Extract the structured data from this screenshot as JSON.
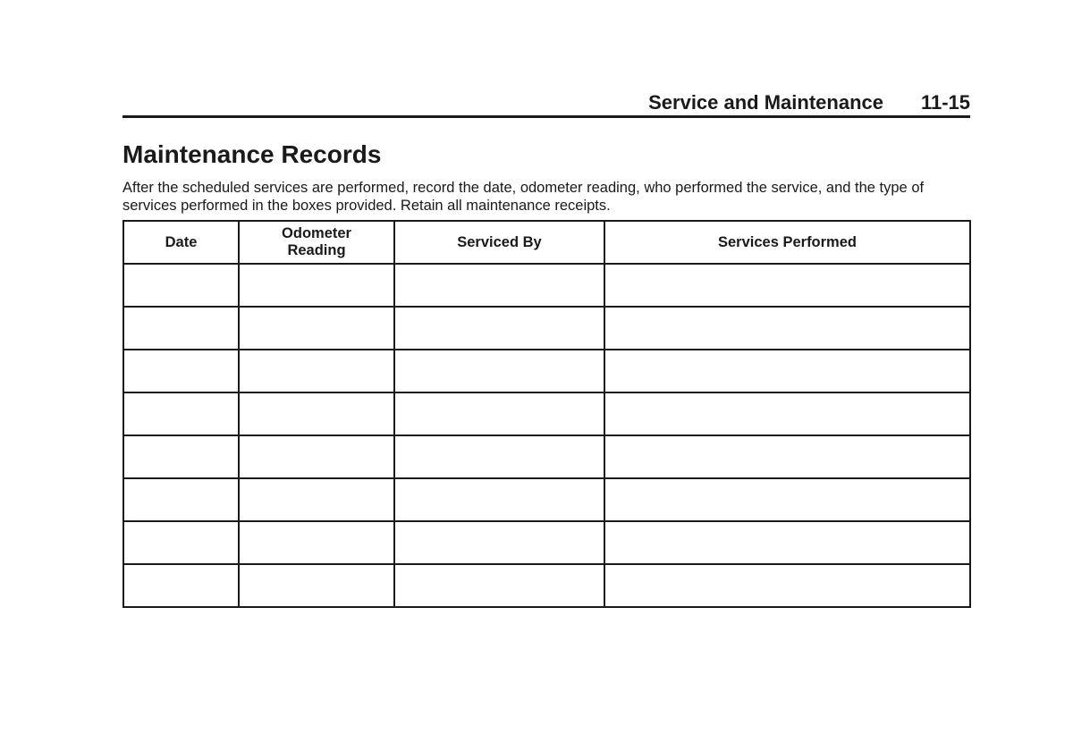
{
  "header": {
    "section": "Service and Maintenance",
    "page_number": "11-15"
  },
  "title": "Maintenance Records",
  "intro": "After the scheduled services are performed, record the date, odometer reading, who performed the service, and the type of services performed in the boxes provided. Retain all maintenance receipts.",
  "table": {
    "columns": [
      {
        "line1": "Date",
        "line2": ""
      },
      {
        "line1": "Odometer",
        "line2": "Reading"
      },
      {
        "line1": "Serviced By",
        "line2": ""
      },
      {
        "line1": "Services Performed",
        "line2": ""
      }
    ],
    "rows": [
      [
        "",
        "",
        "",
        ""
      ],
      [
        "",
        "",
        "",
        ""
      ],
      [
        "",
        "",
        "",
        ""
      ],
      [
        "",
        "",
        "",
        ""
      ],
      [
        "",
        "",
        "",
        ""
      ],
      [
        "",
        "",
        "",
        ""
      ],
      [
        "",
        "",
        "",
        ""
      ],
      [
        "",
        "",
        "",
        ""
      ]
    ]
  }
}
